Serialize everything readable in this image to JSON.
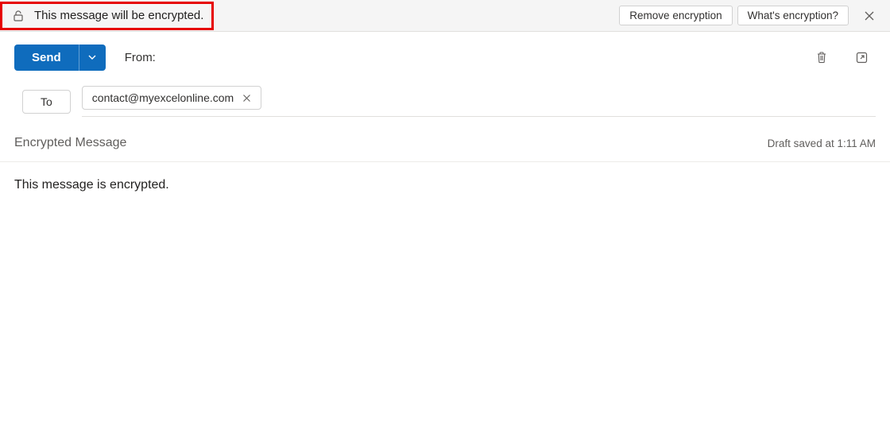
{
  "notification": {
    "message": "This message will be encrypted.",
    "remove_btn": "Remove encryption",
    "whats_btn": "What's encryption?"
  },
  "toolbar": {
    "send_label": "Send",
    "from_label": "From:"
  },
  "recipients": {
    "to_label": "To",
    "chip_email": "contact@myexcelonline.com"
  },
  "subject": {
    "text": "Encrypted Message",
    "draft_status": "Draft saved at 1:11 AM"
  },
  "body": {
    "content": "This message is encrypted."
  }
}
